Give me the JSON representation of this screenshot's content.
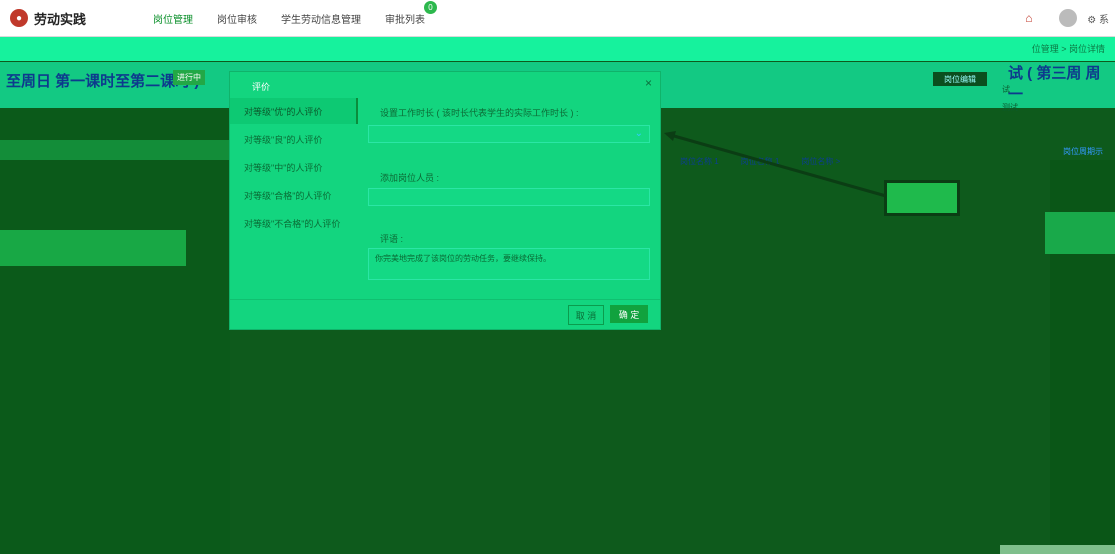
{
  "app": {
    "title": "劳动实践"
  },
  "nav": {
    "items": [
      "岗位管理",
      "岗位审核",
      "学生劳动信息管理",
      "审批列表"
    ],
    "badge": "0"
  },
  "header_right": {
    "settings_label": "系"
  },
  "breadcrumb": "位管理 > 岗位详情",
  "page": {
    "title": "至周日 第一课时至第二课时 )",
    "status": "进行中",
    "edit_button": "岗位编辑",
    "right_title": "试 ( 第三周 周一",
    "right_sub1": "试",
    "right_sub2": "测试",
    "right_link": "岗位周期示",
    "mid_tabs": [
      "岗位名称 1",
      "岗位名称 1",
      "岗位名称 >"
    ]
  },
  "modal": {
    "title": "评价",
    "side_items": [
      "对等级\"优\"的人评价",
      "对等级\"良\"的人评价",
      "对等级\"中\"的人评价",
      "对等级\"合格\"的人评价",
      "对等级\"不合格\"的人评价"
    ],
    "work_time_label": "设置工作时长 ( 该时长代表学生的实际工作时长 ) :",
    "add_people_label": "添加岗位人员 :",
    "comment_label": "评语 :",
    "comment_text": "你完美地完成了该岗位的劳动任务，要继续保持。",
    "cancel": "取 消",
    "ok": "确 定"
  }
}
